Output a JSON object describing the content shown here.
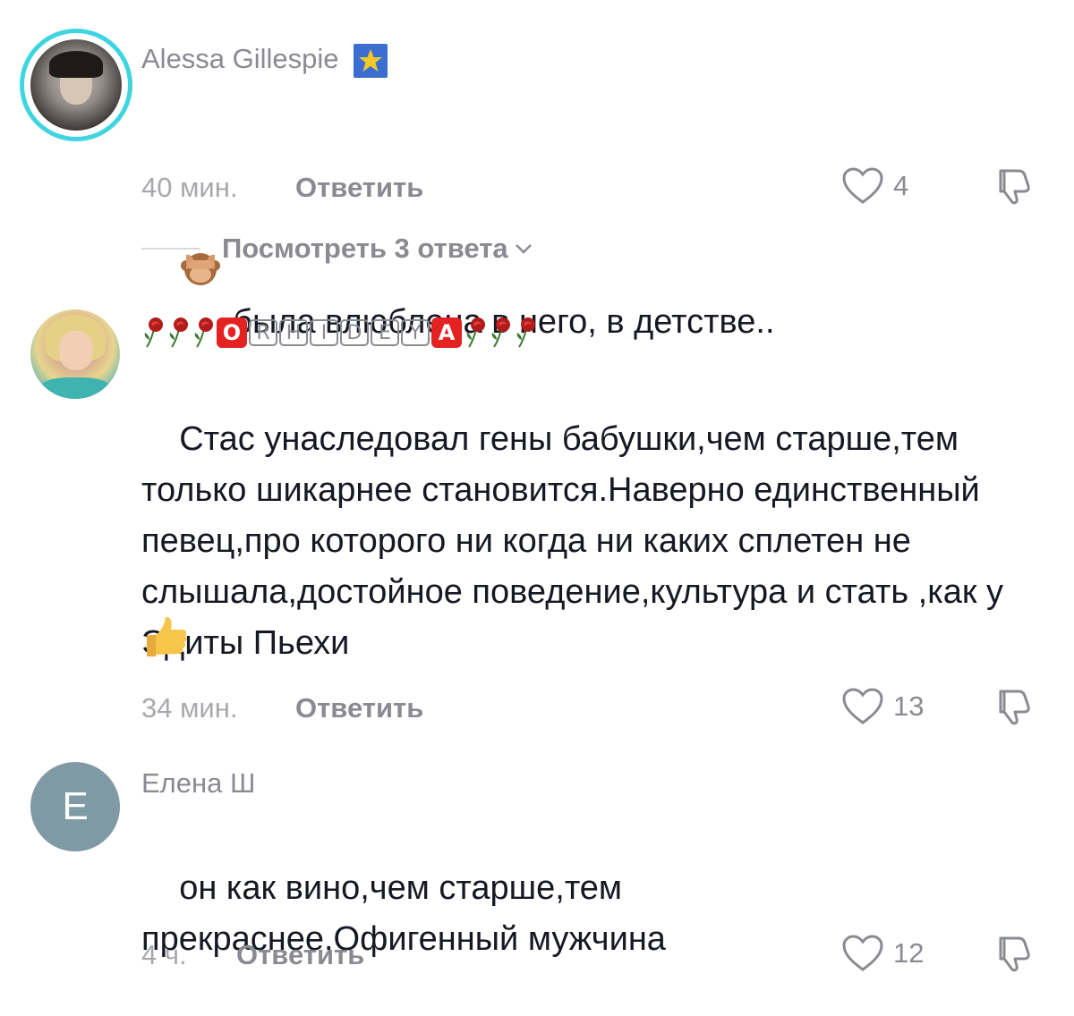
{
  "comments": [
    {
      "username": "Alessa Gillespie",
      "badge_icon": "star-badge-icon",
      "lead_emoji": "see-no-evil-monkey-emoji",
      "text": "была влюблена в него, в детстве..",
      "time": "40 мин.",
      "reply_label": "Ответить",
      "likes": "4",
      "view_replies": "Посмотреть 3 ответа"
    },
    {
      "username_letters": [
        "O",
        "R",
        "H",
        "I",
        "D",
        "E",
        "Y",
        "A"
      ],
      "username_decor_icon": "rose-icon",
      "text": "Стас унаследовал гены бабушки,чем старше,тем только шикарнее становится.Наверно единственный певец,про которого ни когда ни каких сплетен не слышала,достойное поведение,культура и стать ,как у Эдиты Пьехи",
      "trail_emoji": "thumbs-up-emoji",
      "time": "34 мин.",
      "reply_label": "Ответить",
      "likes": "13"
    },
    {
      "username": "Елена Ш",
      "avatar_letter": "Е",
      "text": "он как вино,чем старше,тем прекраснее.Офигенный мужчина",
      "time": "4 ч.",
      "reply_label": "Ответить",
      "likes": "12"
    }
  ],
  "colors": {
    "avatar_ring": "#3fd5e0",
    "letter_avatar_bg": "#7f9aa5",
    "text_primary": "#161823",
    "text_secondary": "#8a8b91"
  }
}
